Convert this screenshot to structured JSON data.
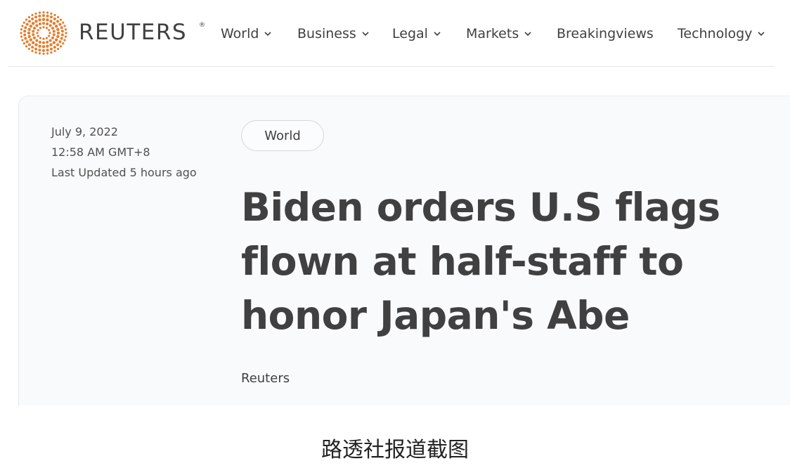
{
  "header": {
    "logo_text": "REUTERS",
    "logo_registered": "®",
    "logo_icon": "reuters-dot-sunburst",
    "nav": [
      {
        "label": "World",
        "dropdown": true
      },
      {
        "label": "Business",
        "dropdown": true
      },
      {
        "label": "Legal",
        "dropdown": true
      },
      {
        "label": "Markets",
        "dropdown": true
      },
      {
        "label": "Breakingviews",
        "dropdown": false
      },
      {
        "label": "Technology",
        "dropdown": true
      }
    ]
  },
  "article": {
    "date": "July 9, 2022",
    "time": "12:58 AM GMT+8",
    "updated": "Last Updated 5 hours ago",
    "section_tag": "World",
    "headline": "Biden orders U.S flags flown at half-staff to honor Japan's Abe",
    "byline": "Reuters"
  },
  "caption": "路透社报道截图",
  "colors": {
    "logo_orange": "#e57c2c",
    "text": "#404040",
    "card_bg": "#f9fafc"
  }
}
